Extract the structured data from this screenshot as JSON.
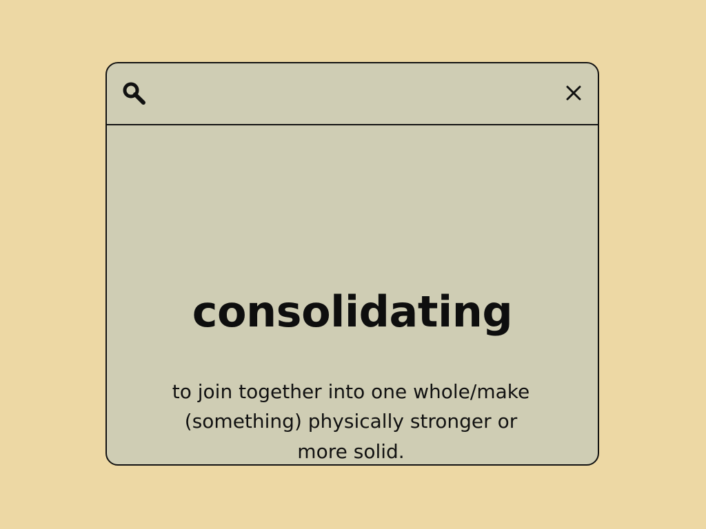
{
  "colors": {
    "background": "#EDD8A4",
    "panel": "#CFCDB4",
    "ink": "#111111"
  },
  "toolbar": {
    "search_icon": "search-icon",
    "close_icon": "close-icon"
  },
  "entry": {
    "word": "consolidating",
    "definition": "to join together into one whole/make (something) physically stronger or more solid."
  }
}
